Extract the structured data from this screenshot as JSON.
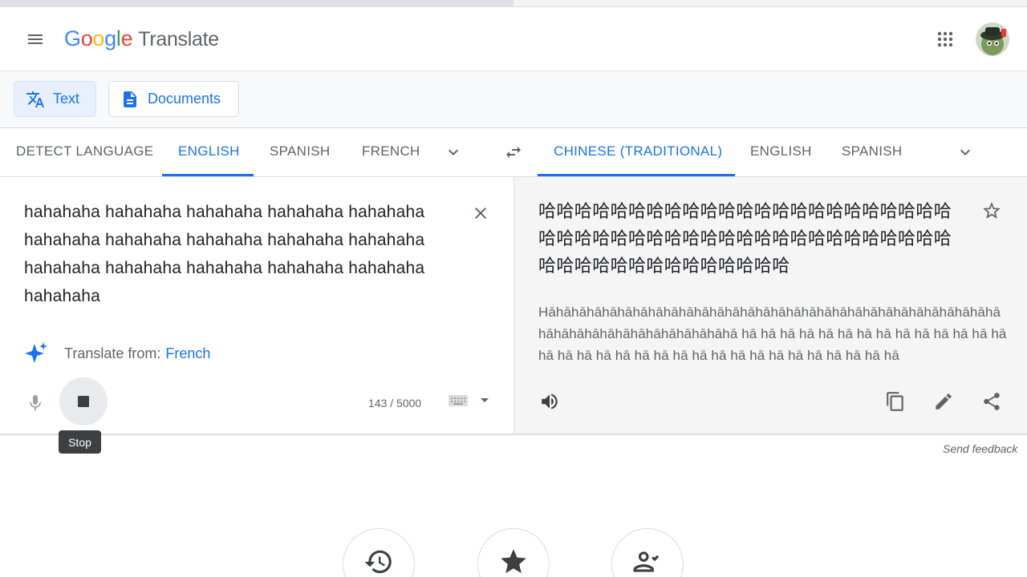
{
  "header": {
    "logo_letters": [
      "G",
      "o",
      "o",
      "g",
      "l",
      "e"
    ],
    "product": "Translate"
  },
  "modes": [
    {
      "label": "Text",
      "active": true
    },
    {
      "label": "Documents",
      "active": false
    }
  ],
  "source_langs": [
    "Detect language",
    "English",
    "Spanish",
    "French"
  ],
  "source_active": "English",
  "target_langs": [
    "Chinese (Traditional)",
    "English",
    "Spanish"
  ],
  "target_active": "Chinese (Traditional)",
  "source": {
    "text": "hahahaha hahahaha hahahaha hahahaha hahahaha hahahaha hahahaha hahahaha hahahaha hahahaha hahahaha hahahaha hahahaha hahahaha hahahaha hahahaha",
    "translate_from_label": "Translate from:",
    "translate_from_lang": "French",
    "char_count": "143 / 5000",
    "stop_tooltip": "Stop"
  },
  "target": {
    "text": "哈哈哈哈哈哈哈哈哈哈哈哈哈哈哈哈哈哈哈哈哈哈哈哈哈哈哈哈哈哈哈哈哈哈哈哈哈哈哈哈哈哈哈哈哈哈哈哈哈哈哈哈哈哈哈哈哈哈哈哈",
    "transliteration": "Hāhāhāhāhāhāhāhāhāhāhāhāhāhāhāhāhāhāhāhāhāhāhāhāhāhāhāhāhāhāhāhāhāhāhāhāhāhāhāhāhāhāhā hā hā hā hā hā hā hā hā hā hā hā hā hā hā hā hā hā hā hā hā hā hā hā hā hā hā hā hā hā hā hā hā hā"
  },
  "send_feedback": "Send feedback",
  "colors": {
    "accent": "#1a73e8",
    "muted": "#5f6368",
    "panel": "#f5f5f5"
  }
}
